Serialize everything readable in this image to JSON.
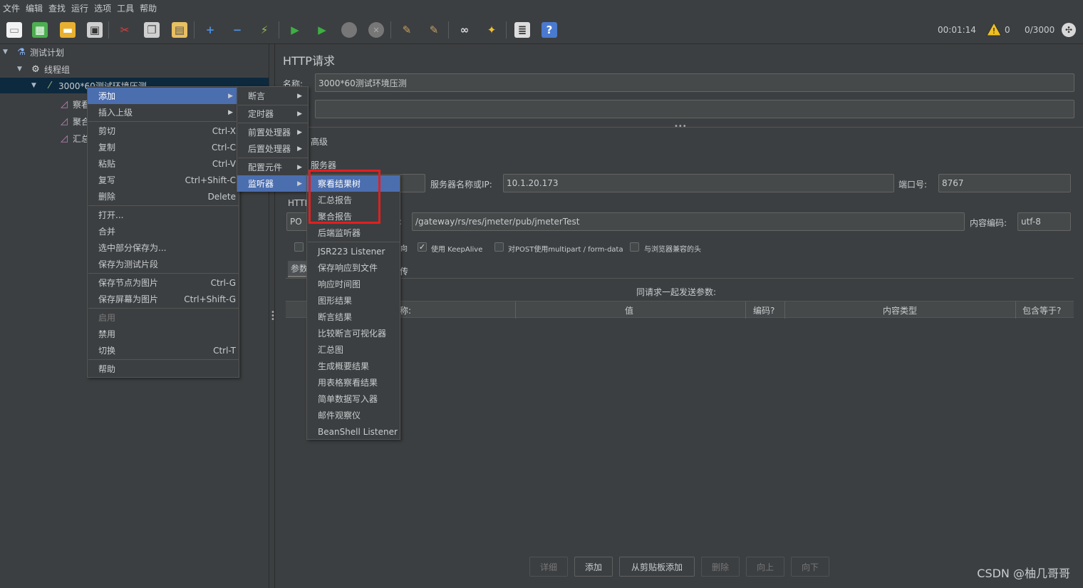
{
  "menubar": [
    "文件",
    "编辑",
    "查找",
    "运行",
    "选项",
    "工具",
    "帮助"
  ],
  "status": {
    "time": "00:01:14",
    "warnings": "0",
    "threads": "0/3000"
  },
  "tree": {
    "plan": "测试计划",
    "thread_group": "线程组",
    "sampler": "3000*60测试环境压测",
    "children": [
      "察看",
      "聚合",
      "汇总"
    ]
  },
  "main": {
    "title": "HTTP请求",
    "name_label": "名称:",
    "name_value": "3000*60测试环境压测",
    "advanced_tab": "高级",
    "web_server_label": "服务器",
    "server_ip_label": "服务器名称或IP:",
    "server_ip": "10.1.20.173",
    "port_label": "端口号:",
    "port": "8767",
    "http_label": "HTTI",
    "method": "PO",
    "path": "/gateway/rs/res/jmeter/pub/jmeterTest",
    "encoding_label": "内容编码:",
    "encoding": "utf-8",
    "opt_redirect": "向",
    "opt_keepalive": "使用 KeepAlive",
    "opt_multipart": "对POST使用multipart / form-data",
    "opt_browser_headers": "与浏览器兼容的头",
    "params_tab": "参数",
    "files_tab": "传",
    "send_params": "同请求一起发送参数:",
    "columns": [
      "称:",
      "值",
      "编码?",
      "内容类型",
      "包含等于?"
    ],
    "buttons": [
      "详细",
      "添加",
      "从剪贴板添加",
      "删除",
      "向上",
      "向下"
    ]
  },
  "context_menu": {
    "items": [
      {
        "label": "添加",
        "shortcut": ""
      },
      {
        "label": "插入上级",
        "shortcut": ""
      },
      {
        "label": "剪切",
        "shortcut": "Ctrl-X"
      },
      {
        "label": "复制",
        "shortcut": "Ctrl-C"
      },
      {
        "label": "粘贴",
        "shortcut": "Ctrl-V"
      },
      {
        "label": "复写",
        "shortcut": "Ctrl+Shift-C"
      },
      {
        "label": "删除",
        "shortcut": "Delete"
      },
      {
        "label": "打开...",
        "shortcut": ""
      },
      {
        "label": "合并",
        "shortcut": ""
      },
      {
        "label": "选中部分保存为...",
        "shortcut": ""
      },
      {
        "label": "保存为测试片段",
        "shortcut": ""
      },
      {
        "label": "保存节点为图片",
        "shortcut": "Ctrl-G"
      },
      {
        "label": "保存屏幕为图片",
        "shortcut": "Ctrl+Shift-G"
      },
      {
        "label": "启用",
        "shortcut": ""
      },
      {
        "label": "禁用",
        "shortcut": ""
      },
      {
        "label": "切换",
        "shortcut": "Ctrl-T"
      },
      {
        "label": "帮助",
        "shortcut": ""
      }
    ]
  },
  "add_submenu": [
    "断言",
    "定时器",
    "前置处理器",
    "后置处理器",
    "配置元件",
    "监听器"
  ],
  "listener_submenu": [
    "察看结果树",
    "汇总报告",
    "聚合报告",
    "后端监听器",
    "JSR223 Listener",
    "保存响应到文件",
    "响应时间图",
    "图形结果",
    "断言结果",
    "比较断言可视化器",
    "汇总图",
    "生成概要结果",
    "用表格察看结果",
    "简单数据写入器",
    "邮件观察仪",
    "BeanShell Listener"
  ],
  "watermark": "CSDN @柚几哥哥",
  "colors": {
    "selected": "#4b6eaf",
    "highlight": "#e02020",
    "background": "#3c3f41"
  }
}
